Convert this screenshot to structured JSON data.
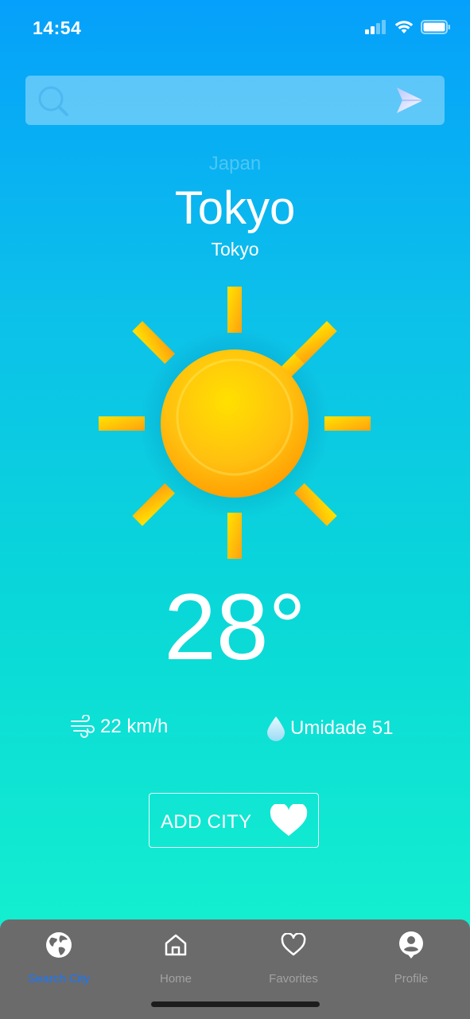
{
  "status_bar": {
    "time": "14:54",
    "icons": [
      "cellular-signal-icon",
      "wifi-icon",
      "battery-icon"
    ]
  },
  "search": {
    "value": "",
    "placeholder": ""
  },
  "location": {
    "country": "Japan",
    "city": "Tokyo",
    "region": "Tokyo"
  },
  "weather": {
    "icon": "sun-icon",
    "temperature": "28°",
    "wind": "22 km/h",
    "humidity": "Umidade 51"
  },
  "add_city": {
    "label": "ADD CITY",
    "icon": "heart-icon"
  },
  "tabs": [
    {
      "label": "Search City",
      "icon": "globe-icon",
      "active": true
    },
    {
      "label": "Home",
      "icon": "home-icon",
      "active": false
    },
    {
      "label": "Favorites",
      "icon": "heart-outline-icon",
      "active": false
    },
    {
      "label": "Profile",
      "icon": "user-icon",
      "active": false
    }
  ],
  "colors": {
    "gradient_top": "#05a0fb",
    "gradient_bottom": "#16f5cd",
    "tabbar": "#6b6b6b",
    "active_tab": "#1677ff",
    "inactive_tab": "#a2a2a2",
    "sun": "#ffc107"
  }
}
